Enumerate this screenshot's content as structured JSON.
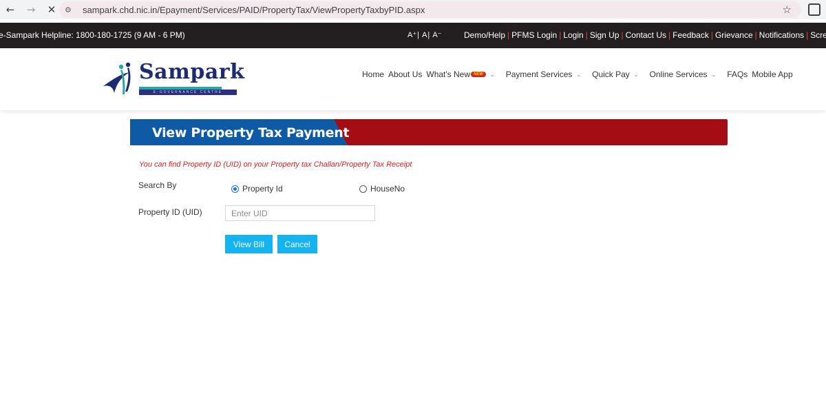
{
  "browser": {
    "back_icon": "←",
    "forward_icon": "→",
    "close_icon": "✕",
    "url": "sampark.chd.nic.in/Epayment/Services/PAID/PropertyTax/ViewPropertyTaxbyPID.aspx",
    "star_icon": "☆"
  },
  "topbar": {
    "helpline": "e-Sampark Helpline: 1800-180-1725 (9 AM - 6 PM)",
    "font_controls": [
      "A⁺",
      "A",
      "A⁻"
    ],
    "links": [
      "Demo/Help",
      "PFMS Login",
      "Login",
      "Sign Up",
      "Contact Us",
      "Feedback",
      "Grievance",
      "Notifications",
      "Screen Rea"
    ]
  },
  "logo": {
    "name": "Sampark",
    "tagline": "E-GOVERNANCE CENTRE"
  },
  "nav": {
    "home": "Home",
    "about": "About Us",
    "whats_new": "What's New",
    "new_badge": "NEW",
    "payment_services": "Payment Services",
    "quick_pay": "Quick Pay",
    "online_services": "Online Services",
    "faqs": "FAQs",
    "mobile_app": "Mobile App"
  },
  "page": {
    "title": "View Property Tax Payment",
    "note": "You can find Property ID (UID) on your Property tax Challan/Property Tax Receipt",
    "search_by_label": "Search By",
    "radio_property_id": "Property Id",
    "radio_house_no": "HouseNo",
    "selected": "Property Id",
    "uid_label": "Property ID (UID)",
    "uid_placeholder": "Enter UID",
    "uid_value": "",
    "view_bill": "View Bill",
    "cancel": "Cancel"
  },
  "colors": {
    "banner_red": "#a50d14",
    "banner_blue": "#0f5aa5",
    "button": "#13b4f0",
    "note_red": "#e02020",
    "topstrip": "#231f20"
  }
}
